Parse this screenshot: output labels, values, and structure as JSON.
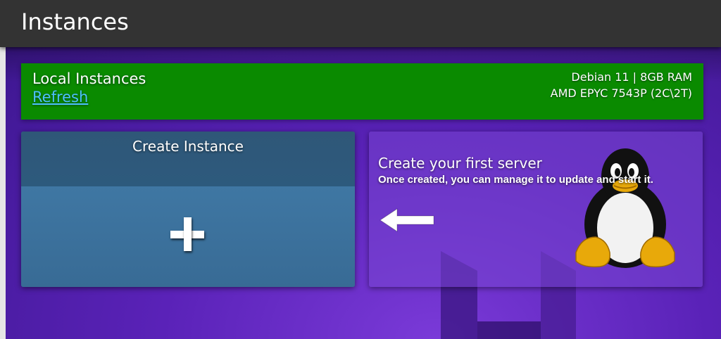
{
  "header": {
    "title": "Instances"
  },
  "banner": {
    "title": "Local Instances",
    "refresh_label": "Refresh",
    "spec_line1": "Debian  11 | 8GB RAM",
    "spec_line2": "AMD EPYC 7543P (2C\\2T)",
    "color": "#0a8a00"
  },
  "create_card": {
    "title": "Create Instance",
    "icon": "plus-icon",
    "color": "#3a6d99"
  },
  "info_card": {
    "heading": "Create your first server",
    "subtext": "Once created, you can manage it to update and start it.",
    "arrow_icon": "arrow-left-icon",
    "mascot_icon": "tux-penguin-icon"
  },
  "colors": {
    "topbar": "#333333",
    "background": "#5a22b8",
    "link": "#4dbfff"
  }
}
